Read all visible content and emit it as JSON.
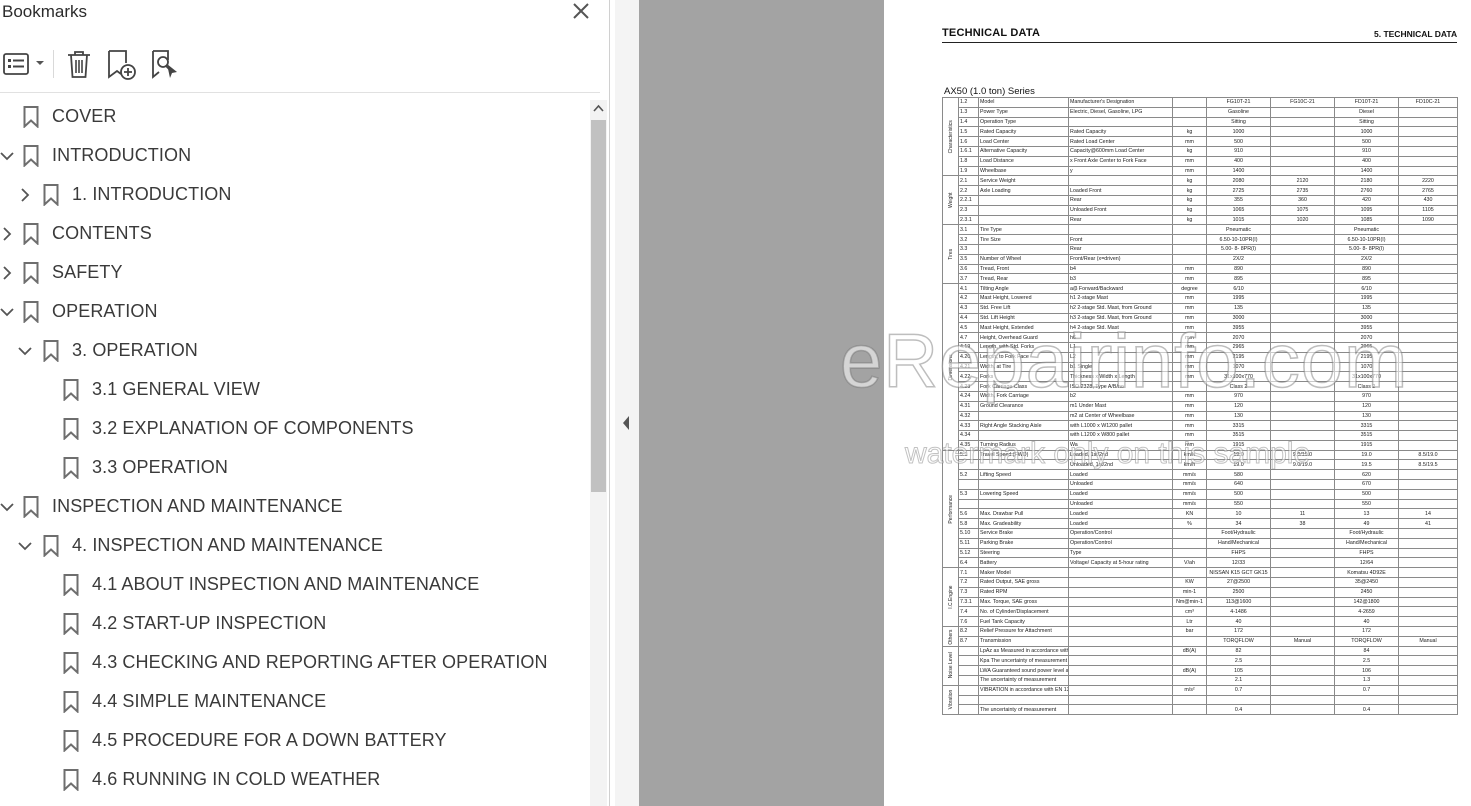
{
  "sidebar": {
    "title": "Bookmarks",
    "items": [
      {
        "label": "COVER"
      },
      {
        "label": "INTRODUCTION"
      },
      {
        "label": "1. INTRODUCTION"
      },
      {
        "label": "CONTENTS"
      },
      {
        "label": "SAFETY"
      },
      {
        "label": "OPERATION"
      },
      {
        "label": "3. OPERATION"
      },
      {
        "label": "3.1 GENERAL VIEW"
      },
      {
        "label": "3.2 EXPLANATION OF COMPONENTS"
      },
      {
        "label": "3.3 OPERATION"
      },
      {
        "label": "INSPECTION AND MAINTENANCE"
      },
      {
        "label": "4. INSPECTION AND MAINTENANCE"
      },
      {
        "label": "4.1 ABOUT INSPECTION AND MAINTENANCE"
      },
      {
        "label": "4.2 START-UP INSPECTION"
      },
      {
        "label": "4.3 CHECKING AND REPORTING AFTER OPERATION"
      },
      {
        "label": "4.4 SIMPLE MAINTENANCE"
      },
      {
        "label": "4.5 PROCEDURE FOR A DOWN BATTERY"
      },
      {
        "label": "4.6 RUNNING IN COLD WEATHER"
      }
    ]
  },
  "document": {
    "header_left": "TECHNICAL DATA",
    "header_right": "5. TECHNICAL DATA",
    "series_title": "AX50 (1.0 ton) Series",
    "watermark": "eRepairinfo.com",
    "watermark_sub": "watermark only on this sample",
    "groups": [
      "Characteristics",
      "Weight",
      "Tires",
      "Dimensions",
      "Performance",
      "I.C.Engine",
      "Others",
      "Noise Level",
      "Vibration"
    ],
    "rows": [
      [
        "1.2",
        "Model",
        "Manufacturer's Designation",
        "",
        "FG10T-21",
        "FG10C-21",
        "FD10T-21",
        "FD10C-21"
      ],
      [
        "1.3",
        "Power Type",
        "Electric, Diesel, Gasoline, LPG",
        "",
        "Gasoline",
        "",
        "Diesel",
        ""
      ],
      [
        "1.4",
        "Operation Type",
        "",
        "",
        "Sitting",
        "",
        "Sitting",
        ""
      ],
      [
        "1.5",
        "Rated Capacity",
        "Rated Capacity",
        "kg",
        "1000",
        "",
        "1000",
        ""
      ],
      [
        "1.6",
        "Load Center",
        "Rated Load Center",
        "mm",
        "500",
        "",
        "500",
        ""
      ],
      [
        "1.6.1",
        "Alternative Capacity",
        "Capacity@600mm Load Center",
        "kg",
        "910",
        "",
        "910",
        ""
      ],
      [
        "1.8",
        "Load Distance",
        "x   Front Axle Center to Fork Face",
        "mm",
        "400",
        "",
        "400",
        ""
      ],
      [
        "1.9",
        "Wheelbase",
        "y",
        "mm",
        "1400",
        "",
        "1400",
        ""
      ],
      [
        "2.1",
        "Service Weight",
        "",
        "kg",
        "2080",
        "2120",
        "2180",
        "2220"
      ],
      [
        "2.2",
        "Axle Loading",
        "Loaded   Front",
        "kg",
        "2725",
        "2735",
        "2760",
        "2765"
      ],
      [
        "2.2.1",
        "",
        "Rear",
        "kg",
        "355",
        "360",
        "420",
        "430"
      ],
      [
        "2.3",
        "",
        "Unloaded   Front",
        "kg",
        "1065",
        "1075",
        "1095",
        "1105"
      ],
      [
        "2.3.1",
        "",
        "Rear",
        "kg",
        "1015",
        "1020",
        "1085",
        "1090"
      ],
      [
        "3.1",
        "Tire Type",
        "",
        "",
        "Pneumatic",
        "",
        "Pneumatic",
        ""
      ],
      [
        "3.2",
        "Tire Size",
        "Front",
        "",
        "6.50-10-10PR(I)",
        "",
        "6.50-10-10PR(I)",
        ""
      ],
      [
        "3.3",
        "",
        "Rear",
        "",
        "5.00- 8- 8PR(I)",
        "",
        "5.00- 8- 8PR(I)",
        ""
      ],
      [
        "3.5",
        "Number of Wheel",
        "Front/Rear (x=driven)",
        "",
        "2X/2",
        "",
        "2X/2",
        ""
      ],
      [
        "3.6",
        "Tread, Front",
        "b4",
        "mm",
        "890",
        "",
        "890",
        ""
      ],
      [
        "3.7",
        "Tread, Rear",
        "b3",
        "mm",
        "895",
        "",
        "895",
        ""
      ],
      [
        "4.1",
        "Tilting Angle",
        "a/β  Forward/Backward",
        "degree",
        "6/10",
        "",
        "6/10",
        ""
      ],
      [
        "4.2",
        "Mast Height, Lowered",
        "h1  2-stage Mast",
        "mm",
        "1995",
        "",
        "1995",
        ""
      ],
      [
        "4.3",
        "Std. Free Lift",
        "h2  2-stage Std. Mast, from Ground",
        "mm",
        "135",
        "",
        "135",
        ""
      ],
      [
        "4.4",
        "Std. Lift Height",
        "h3  2-stage Std. Mast, from Ground",
        "mm",
        "3000",
        "",
        "3000",
        ""
      ],
      [
        "4.5",
        "Mast Height, Extended",
        "h4  2-stage Std. Mast",
        "mm",
        "3955",
        "",
        "3955",
        ""
      ],
      [
        "4.7",
        "Height, Overhead Guard",
        "h6",
        "mm",
        "2070",
        "",
        "2070",
        ""
      ],
      [
        "4.19",
        "Length, with Std. Forks",
        "L1",
        "mm",
        "2965",
        "",
        "2965",
        ""
      ],
      [
        "4.20",
        "Length, to Fork Face",
        "L2",
        "mm",
        "2195",
        "",
        "2195",
        ""
      ],
      [
        "4.21",
        "Width, at Tire",
        "b1  Single",
        "mm",
        "1070",
        "",
        "1070",
        ""
      ],
      [
        "4.22",
        "Forks",
        "Thickness x Width x Length",
        "mm",
        "31x100x770",
        "",
        "31x100x770",
        ""
      ],
      [
        "4.23",
        "Fork Carriage Class",
        "ISO 2328, Type A/B/no",
        "",
        "Class 2",
        "",
        "Class 2",
        ""
      ],
      [
        "4.24",
        "Width, Fork Carriage",
        "b2",
        "mm",
        "970",
        "",
        "970",
        ""
      ],
      [
        "4.31",
        "Ground Clearance",
        "m1  Under Mast",
        "mm",
        "120",
        "",
        "120",
        ""
      ],
      [
        "4.32",
        "",
        "m2  at Center of Wheelbase",
        "mm",
        "130",
        "",
        "130",
        ""
      ],
      [
        "4.33",
        "Right Angle Stacking Aisle",
        "with L1000 x W1200 pallet",
        "mm",
        "3315",
        "",
        "3315",
        ""
      ],
      [
        "4.34",
        "",
        "with L1200 x W800 pallet",
        "mm",
        "3515",
        "",
        "3515",
        ""
      ],
      [
        "4.35",
        "Turning Radius",
        "Wa",
        "mm",
        "1915",
        "",
        "1915",
        ""
      ],
      [
        "5.1",
        "Travel Speed (FWD)",
        "Loaded, 1st/2nd",
        "km/h",
        "19.0",
        "9.0/19.0",
        "19.0",
        "8.5/19.0"
      ],
      [
        "",
        "",
        "Unloaded, 1st/2nd",
        "km/h",
        "19.0",
        "9.0/19.0",
        "19.5",
        "8.5/19.5"
      ],
      [
        "5.2",
        "Lifting Speed",
        "Loaded",
        "mm/s",
        "580",
        "",
        "620",
        ""
      ],
      [
        "",
        "",
        "Unloaded",
        "mm/s",
        "640",
        "",
        "670",
        ""
      ],
      [
        "5.3",
        "Lowering Speed",
        "Loaded",
        "mm/s",
        "500",
        "",
        "500",
        ""
      ],
      [
        "",
        "",
        "Unloaded",
        "mm/s",
        "550",
        "",
        "550",
        ""
      ],
      [
        "5.6",
        "Max. Drawbar Pull",
        "Loaded",
        "KN",
        "10",
        "11",
        "13",
        "14"
      ],
      [
        "5.8",
        "Max. Gradeability",
        "Loaded",
        "%",
        "34",
        "38",
        "49",
        "41"
      ],
      [
        "5.10",
        "Service Brake",
        "Operation/Control",
        "",
        "Foot/Hydraulic",
        "",
        "Foot/Hydraulic",
        ""
      ],
      [
        "5.11",
        "Parking Brake",
        "Operation/Control",
        "",
        "Hand/Mechanical",
        "",
        "Hand/Mechanical",
        ""
      ],
      [
        "5.12",
        "Steering",
        "Type",
        "",
        "FHPS",
        "",
        "FHPS",
        ""
      ],
      [
        "6.4",
        "Battery",
        "Voltage/ Capacity at 5-hour rating",
        "V/ah",
        "12/33",
        "",
        "12/64",
        ""
      ],
      [
        "7.1",
        "Maker Model",
        "",
        "",
        "NISSAN K15  GCT GK15",
        "",
        "Komatsu 4D92E",
        ""
      ],
      [
        "7.2",
        "Rated Output, SAE gross",
        "",
        "KW",
        "27@2500",
        "",
        "35@2450",
        ""
      ],
      [
        "7.3",
        "Rated RPM",
        "",
        "min-1",
        "2500",
        "",
        "2450",
        ""
      ],
      [
        "7.3.1",
        "Max. Torque, SAE gross",
        "",
        "Nm@min-1",
        "113@1600",
        "",
        "142@1800",
        ""
      ],
      [
        "7.4",
        "No. of Cylinder/Displacement",
        "",
        "cm³",
        "4-1486",
        "",
        "4-2659",
        ""
      ],
      [
        "7.6",
        "Fuel Tank Capacity",
        "",
        "Ltr",
        "40",
        "",
        "40",
        ""
      ],
      [
        "8.2",
        "Relief Pressure for Attachment",
        "",
        "bar",
        "172",
        "",
        "172",
        ""
      ],
      [
        "8.7",
        "Transmission",
        "",
        "",
        "TORQFLOW",
        "Manual",
        "TORQFLOW",
        "Manual"
      ],
      [
        "",
        "LpAz as Measured in accordance with EN12053",
        "",
        "dB(A)",
        "82",
        "",
        "84",
        ""
      ],
      [
        "",
        "Kpa The uncertainty of measurement in accordance with EN12053",
        "",
        "",
        "2.5",
        "",
        "2.5",
        ""
      ],
      [
        "",
        "LWA Guaranteed sound power level accordance with 2000/14/EC",
        "",
        "dB(A)",
        "105",
        "",
        "106",
        ""
      ],
      [
        "",
        "The uncertainty of measurement",
        "",
        "",
        "2.1",
        "",
        "1.3",
        ""
      ],
      [
        "",
        "VIBRATION in accordance with EN 13059",
        "",
        "m/s²",
        "0.7",
        "",
        "0.7",
        ""
      ],
      [
        "",
        "",
        "",
        "",
        "",
        "",
        "",
        ""
      ],
      [
        "",
        "The uncertainty of measurement",
        "",
        "",
        "0.4",
        "",
        "0.4",
        ""
      ]
    ]
  }
}
